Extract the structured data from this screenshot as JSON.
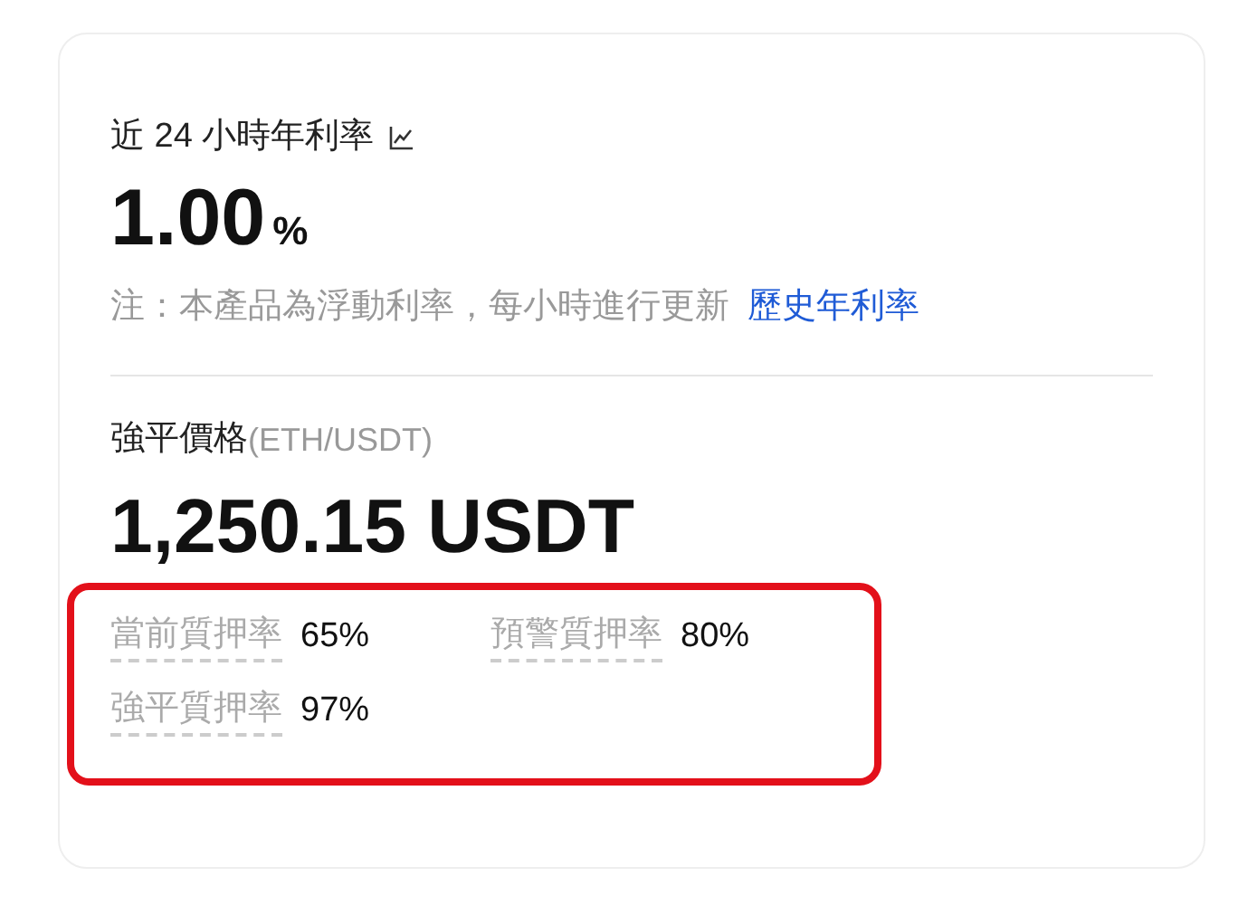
{
  "rate": {
    "title": "近 24 小時年利率",
    "value": "1.00",
    "unit": "%",
    "note": "注：本產品為浮動利率，每小時進行更新",
    "link": "歷史年利率"
  },
  "liquidation": {
    "title": "強平價格",
    "pair": "(ETH/USDT)",
    "price": "1,250.15 USDT"
  },
  "ratios": [
    {
      "label": "當前質押率",
      "value": "65%"
    },
    {
      "label": "預警質押率",
      "value": "80%"
    },
    {
      "label": "強平質押率",
      "value": "97%"
    }
  ],
  "highlight": {
    "color": "#e3101a"
  }
}
